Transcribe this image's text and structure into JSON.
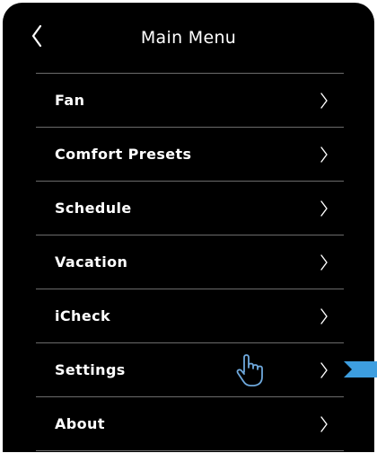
{
  "header": {
    "title": "Main Menu",
    "back_icon": "chevron-left-icon"
  },
  "menu": {
    "items": [
      {
        "label": "Fan"
      },
      {
        "label": "Comfort Presets"
      },
      {
        "label": "Schedule"
      },
      {
        "label": "Vacation"
      },
      {
        "label": "iCheck"
      },
      {
        "label": "Settings"
      },
      {
        "label": "About"
      }
    ],
    "item_icon": "chevron-right-icon"
  },
  "cursor": {
    "icon": "hand-pointer-icon",
    "color": "#6ea8dc"
  },
  "highlight": {
    "icon": "pointer-arrow-icon",
    "color": "#3d9ee0",
    "item": "Settings"
  },
  "colors": {
    "screen_background": "#000000",
    "text": "#ffffff",
    "divider": "#6b6b6b"
  }
}
